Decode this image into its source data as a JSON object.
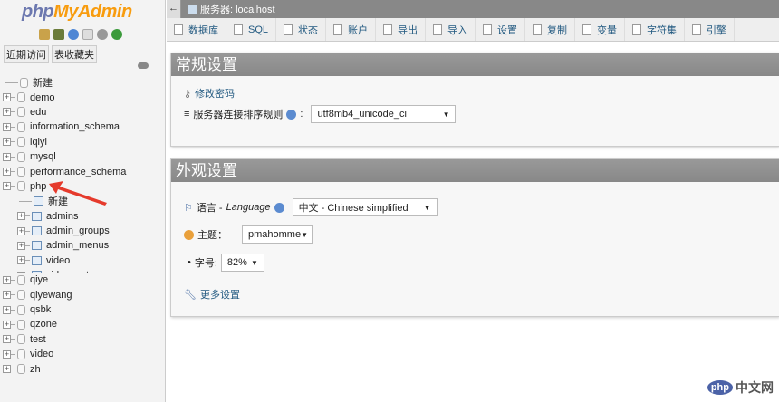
{
  "sidebar": {
    "logo_php": "php",
    "logo_myadmin": "MyAdmin",
    "tabs": [
      "近期访问",
      "表收藏夹"
    ],
    "new_label": "新建",
    "databases_before": [
      "demo",
      "edu",
      "information_schema",
      "iqiyi",
      "mysql",
      "performance_schema",
      "php"
    ],
    "php_children": {
      "new_label": "新建",
      "tables": [
        "admins",
        "admin_groups",
        "admin_menus",
        "video",
        "video_cates"
      ]
    },
    "databases_after": [
      "qiye",
      "qiyewang",
      "qsbk",
      "qzone",
      "test",
      "video",
      "zh"
    ]
  },
  "topbar": {
    "back": "←",
    "server": "服务器: localhost"
  },
  "nav": {
    "tabs": [
      "数据库",
      "SQL",
      "状态",
      "账户",
      "导出",
      "导入",
      "设置",
      "复制",
      "变量",
      "字符集",
      "引擎"
    ]
  },
  "general": {
    "title": "常规设置",
    "change_password": "修改密码",
    "collation_label": "服务器连接排序规则",
    "collation_value": "utf8mb4_unicode_ci"
  },
  "appearance": {
    "title": "外观设置",
    "language_label": "语言 - ",
    "language_en": "Language",
    "language_value": "中文 - Chinese simplified",
    "theme_label": "主题：",
    "theme_value": "pmahomme",
    "fontsize_label": "字号:",
    "fontsize_value": "82%",
    "more_settings": "更多设置"
  },
  "watermark": {
    "logo": "php",
    "text": "中文网"
  },
  "colors": {
    "accent": "#235a81",
    "header": "#888888",
    "brand_orange": "#f89c0e"
  }
}
